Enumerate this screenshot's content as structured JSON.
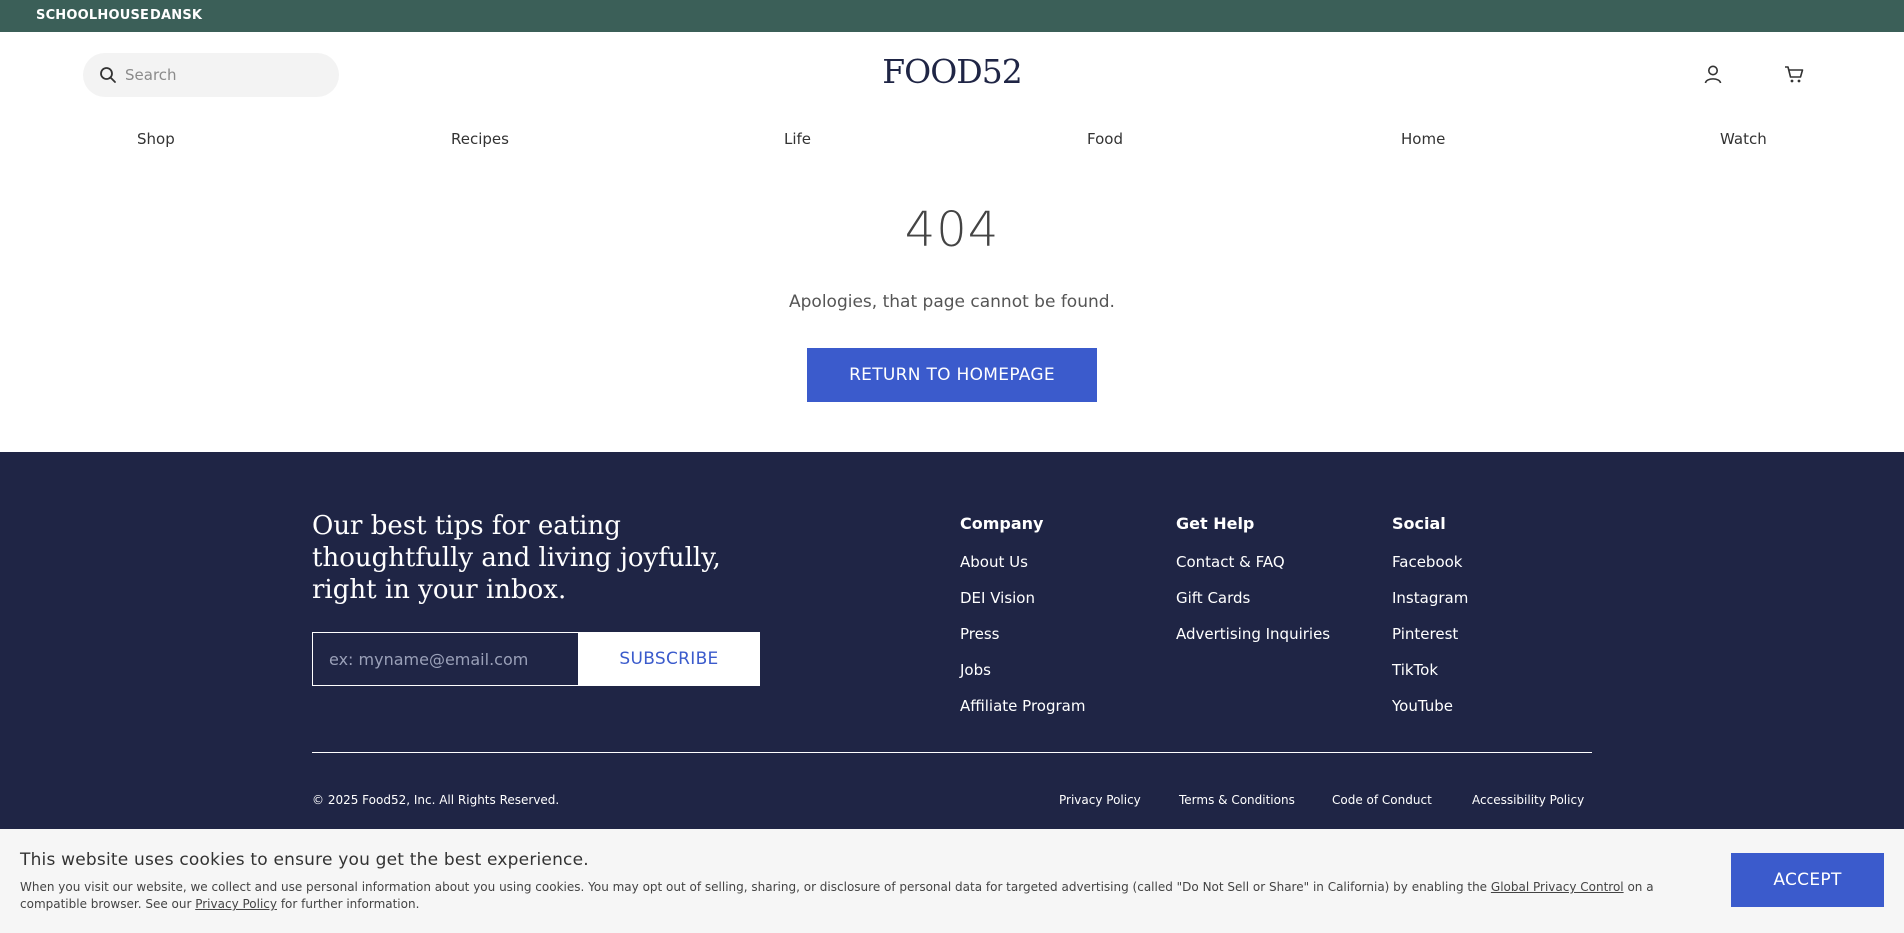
{
  "topbar": {
    "links": [
      "SCHOOLHOUSE",
      "DANSK"
    ],
    "background": "#3b5f58"
  },
  "header": {
    "search_placeholder": "Search",
    "logo": "FOOD52",
    "icons": [
      "search-icon",
      "account-icon",
      "cart-icon"
    ]
  },
  "nav": [
    "Shop",
    "Recipes",
    "Life",
    "Food",
    "Home",
    "Watch"
  ],
  "error": {
    "code": "404",
    "message": "Apologies, that page cannot be found.",
    "button": "RETURN TO HOMEPAGE"
  },
  "footer": {
    "background": "#1f2545",
    "tagline": "Our best tips for eating thoughtfully and living joyfully, right in your inbox.",
    "email_placeholder": "ex: myname@email.com",
    "subscribe_label": "SUBSCRIBE",
    "columns": [
      {
        "title": "Company",
        "links": [
          "About Us",
          "DEI Vision",
          "Press",
          "Jobs",
          "Affiliate Program"
        ]
      },
      {
        "title": "Get Help",
        "links": [
          "Contact & FAQ",
          "Gift Cards",
          "Advertising Inquiries"
        ]
      },
      {
        "title": "Social",
        "links": [
          "Facebook",
          "Instagram",
          "Pinterest",
          "TikTok",
          "YouTube"
        ]
      }
    ],
    "copyright": "© 2025 Food52, Inc. All Rights Reserved.",
    "legal_links": [
      "Privacy Policy",
      "Terms & Conditions",
      "Code of Conduct",
      "Accessibility Policy"
    ]
  },
  "cookie": {
    "title": "This website uses cookies to ensure you get the best experience.",
    "text_before": "When you visit our website, we collect and use personal information about you using cookies. You may opt out of selling, sharing, or disclosure of personal data for targeted advertising (called \"Do Not Sell or Share\" in California) by enabling the ",
    "link1": "Global Privacy Control",
    "text_middle": " on a compatible browser. See our ",
    "link2": "Privacy Policy",
    "text_after": " for further information.",
    "accept_label": "ACCEPT"
  },
  "accent_color": "#3b5bcc"
}
